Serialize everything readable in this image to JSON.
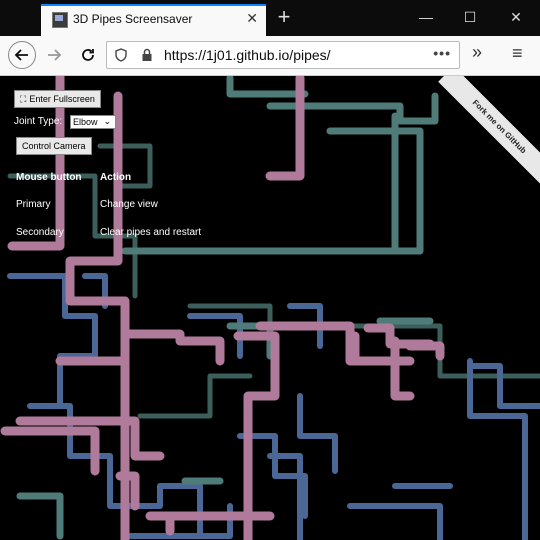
{
  "browser": {
    "tab_title": "3D Pipes Screensaver",
    "tab_close": "✕",
    "new_tab": "+",
    "minimize": "—",
    "maximize": "☐",
    "close": "✕",
    "url": "https://1j01.github.io/pipes/",
    "url_menu": "•••",
    "overflow": "»",
    "menu": "≡"
  },
  "controls": {
    "fullscreen_label": "Enter Fullscreen",
    "joint_type_label": "Joint Type:",
    "joint_type_value": "Elbow",
    "control_camera_label": "Control Camera"
  },
  "mouse_table": {
    "headers": [
      "Mouse button",
      "Action"
    ],
    "rows": [
      [
        "Primary",
        "Change view"
      ],
      [
        "Secondary",
        "Clear pipes and restart"
      ]
    ]
  },
  "github_banner": "Fork me on GitHub",
  "colors": {
    "pink": "#b07a9a",
    "teal": "#4f7c78",
    "blue": "#5875a3",
    "accent": "#0a84ff"
  }
}
